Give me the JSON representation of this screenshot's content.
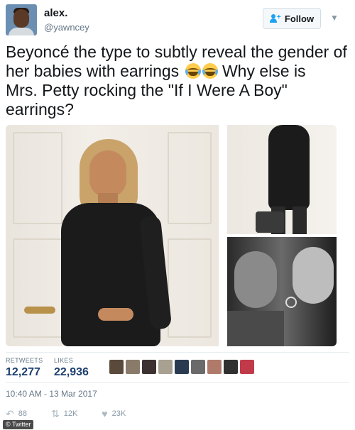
{
  "user": {
    "display_name": "alex.",
    "handle": "@yawncey"
  },
  "follow_button": {
    "label": "Follow"
  },
  "tweet": {
    "text_line1": "Beyoncé the type to subtly reveal the gender of",
    "text_line2_before_emoji": "her babies with earrings",
    "text_line2_after_emoji": "Why else is",
    "text_line3": "Mrs. Petty rocking the \"If I Were A Boy\"",
    "text_line4": "earrings?"
  },
  "stats": {
    "retweets_label": "RETWEETS",
    "retweets_value": "12,277",
    "likes_label": "LIKES",
    "likes_value": "22,936"
  },
  "likers": [
    {
      "color": "#5a4a3c"
    },
    {
      "color": "#8a7a6a"
    },
    {
      "color": "#3c3030"
    },
    {
      "color": "#a8a090"
    },
    {
      "color": "#2a3a50"
    },
    {
      "color": "#6a6a6a"
    },
    {
      "color": "#b07a6a"
    },
    {
      "color": "#303030"
    },
    {
      "color": "#c03a4a"
    }
  ],
  "timestamp": "10:40 AM - 13 Mar 2017",
  "actions": {
    "reply_count": "88",
    "retweet_count": "12K",
    "like_count": "23K"
  },
  "icons": {
    "follow": "person-plus-icon",
    "chevron": "chevron-down-icon",
    "reply": "reply-icon",
    "retweet": "retweet-icon",
    "like": "heart-icon",
    "emoji": "tears-of-joy-emoji"
  },
  "colors": {
    "accent": "#1da1f2",
    "stat_value": "#1c3f6e",
    "muted": "#657786"
  },
  "watermark": "© Twitter"
}
